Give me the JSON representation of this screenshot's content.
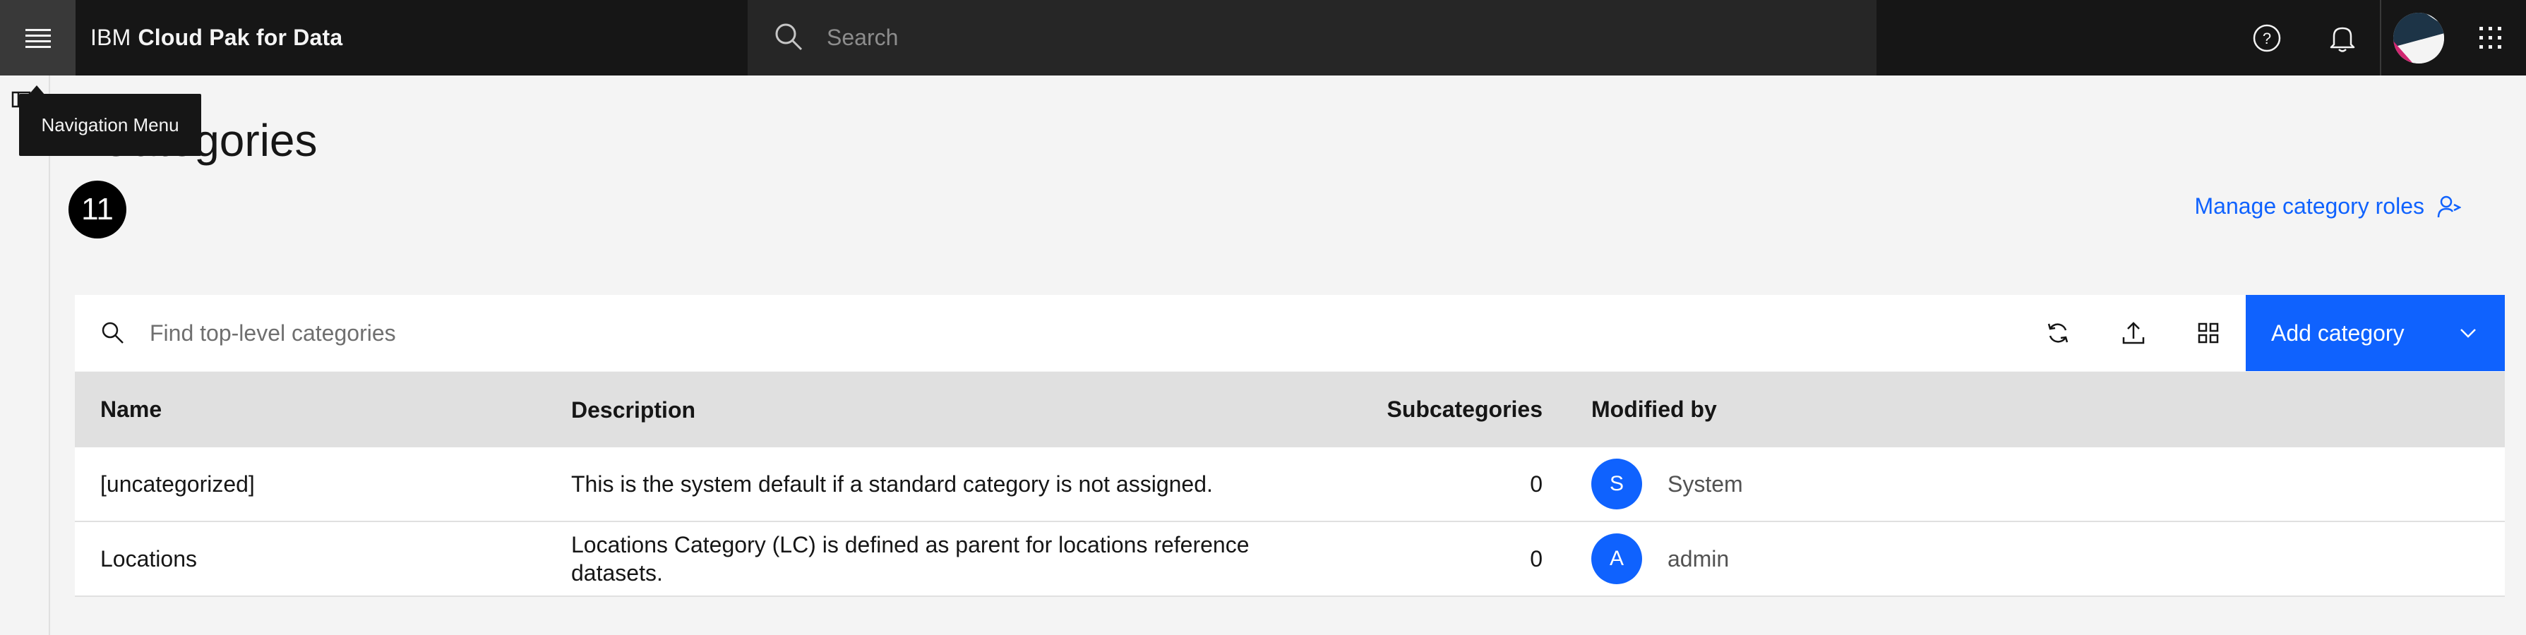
{
  "header": {
    "brand_ibm": "IBM",
    "brand_product": "Cloud Pak for Data",
    "search_placeholder": "Search"
  },
  "tooltip": {
    "text": "Navigation Menu"
  },
  "page": {
    "title": "Categories",
    "count": "11",
    "manage_link": "Manage category roles"
  },
  "toolbar": {
    "search_placeholder": "Find top-level categories",
    "add_label": "Add category"
  },
  "table": {
    "columns": [
      "Name",
      "Description",
      "Subcategories",
      "Modified by"
    ],
    "rows": [
      {
        "name": "[uncategorized]",
        "description": "This is the system default if a standard category is not assigned.",
        "subcategories": "0",
        "modified_initial": "S",
        "modified_by": "System"
      },
      {
        "name": "Locations",
        "description": "Locations Category (LC) is defined as parent for locations reference datasets.",
        "subcategories": "0",
        "modified_initial": "A",
        "modified_by": "admin"
      }
    ]
  },
  "colors": {
    "accent": "#0f62fe",
    "header_bg": "#161616",
    "page_bg": "#f4f4f4"
  },
  "icons": [
    "menu-icon",
    "search-icon",
    "help-icon",
    "notification-icon",
    "app-switcher-icon",
    "refresh-icon",
    "upload-icon",
    "grid-view-icon",
    "chevron-down-icon",
    "user-role-icon"
  ]
}
